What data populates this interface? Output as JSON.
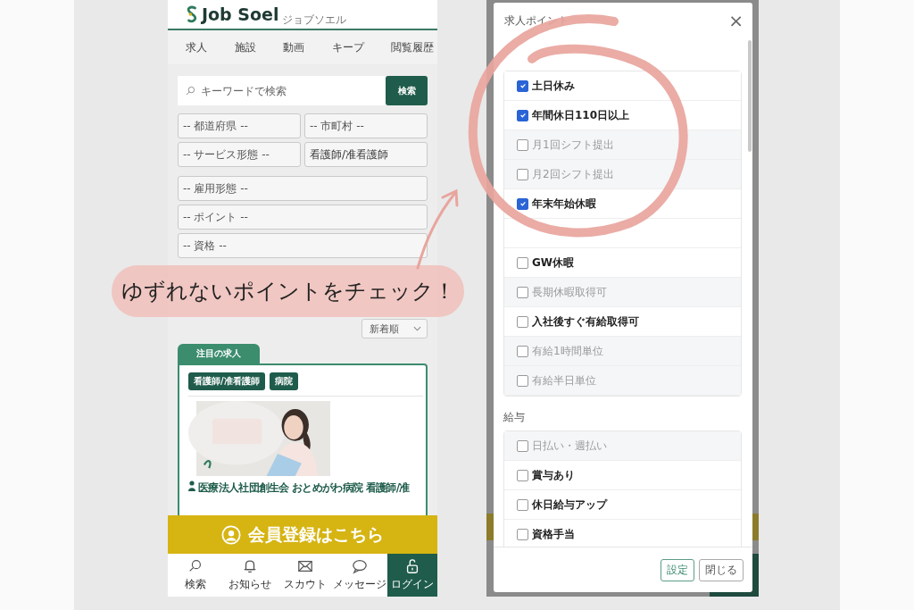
{
  "job_site": {
    "logo": {
      "name": "Job Soel",
      "reading": "ジョブソエル"
    },
    "nav_tabs": [
      "求人",
      "施設",
      "動画",
      "キープ",
      "閲覧履歴"
    ],
    "search": {
      "placeholder": "キーワードで検索",
      "button": "検索"
    },
    "filter_rows": [
      [
        {
          "placeholder": "-- 都道府県 --"
        },
        {
          "placeholder": "-- 市町村 --"
        }
      ],
      [
        {
          "placeholder": "-- サービス形態 --"
        },
        {
          "value": "看護師/准看護師"
        }
      ],
      [
        {
          "placeholder": "-- 雇用形態 --"
        }
      ],
      [
        {
          "placeholder": "-- ポイント --"
        }
      ],
      [
        {
          "placeholder": "-- 資格 --"
        }
      ]
    ],
    "sort": "新着順",
    "featured": {
      "tab": "注目の求人",
      "tags": [
        "看護師/准看護師",
        "病院"
      ],
      "title": "医療法人社団創生会 おとめがわ病院 看護師/准"
    },
    "banner": "会員登録はこちら",
    "bottom_nav": [
      {
        "label": "検索",
        "kind": "plain"
      },
      {
        "label": "お知らせ",
        "kind": "plain"
      },
      {
        "label": "スカウト",
        "kind": "plain"
      },
      {
        "label": "メッセージ",
        "kind": "plain"
      },
      {
        "label": "ログイン",
        "kind": "highlight"
      }
    ]
  },
  "annotation": {
    "text": "ゆずれないポイントをチェック！"
  },
  "modal": {
    "title": "求人ポイント",
    "close": "×",
    "groups": [
      {
        "items": [
          {
            "label": "土日休み",
            "checked": true,
            "disabled": false
          },
          {
            "label": "年間休日110日以上",
            "checked": true,
            "disabled": false
          },
          {
            "label": "月1回シフト提出",
            "checked": false,
            "disabled": true
          },
          {
            "label": "月2回シフト提出",
            "checked": false,
            "disabled": true
          },
          {
            "label": "年末年始休暇",
            "checked": true,
            "disabled": false
          },
          {
            "kind": "obscured"
          },
          {
            "label": "GW休暇",
            "checked": false,
            "disabled": false
          },
          {
            "label": "長期休暇取得可",
            "checked": false,
            "disabled": true
          },
          {
            "label": "入社後すぐ有給取得可",
            "checked": false,
            "disabled": false
          },
          {
            "label": "有給1時間単位",
            "checked": false,
            "disabled": true
          },
          {
            "label": "有給半日単位",
            "checked": false,
            "disabled": true
          }
        ]
      },
      {
        "label": "給与",
        "items": [
          {
            "label": "日払い・週払い",
            "checked": false,
            "disabled": true
          },
          {
            "label": "賞与あり",
            "checked": false,
            "disabled": false
          },
          {
            "label": "休日給与アップ",
            "checked": false,
            "disabled": false
          },
          {
            "label": "資格手当",
            "checked": false,
            "disabled": false
          }
        ]
      }
    ],
    "buttons": [
      {
        "label": "設定",
        "kind": "primary"
      },
      {
        "label": "閉じる",
        "kind": "secondary"
      }
    ]
  }
}
